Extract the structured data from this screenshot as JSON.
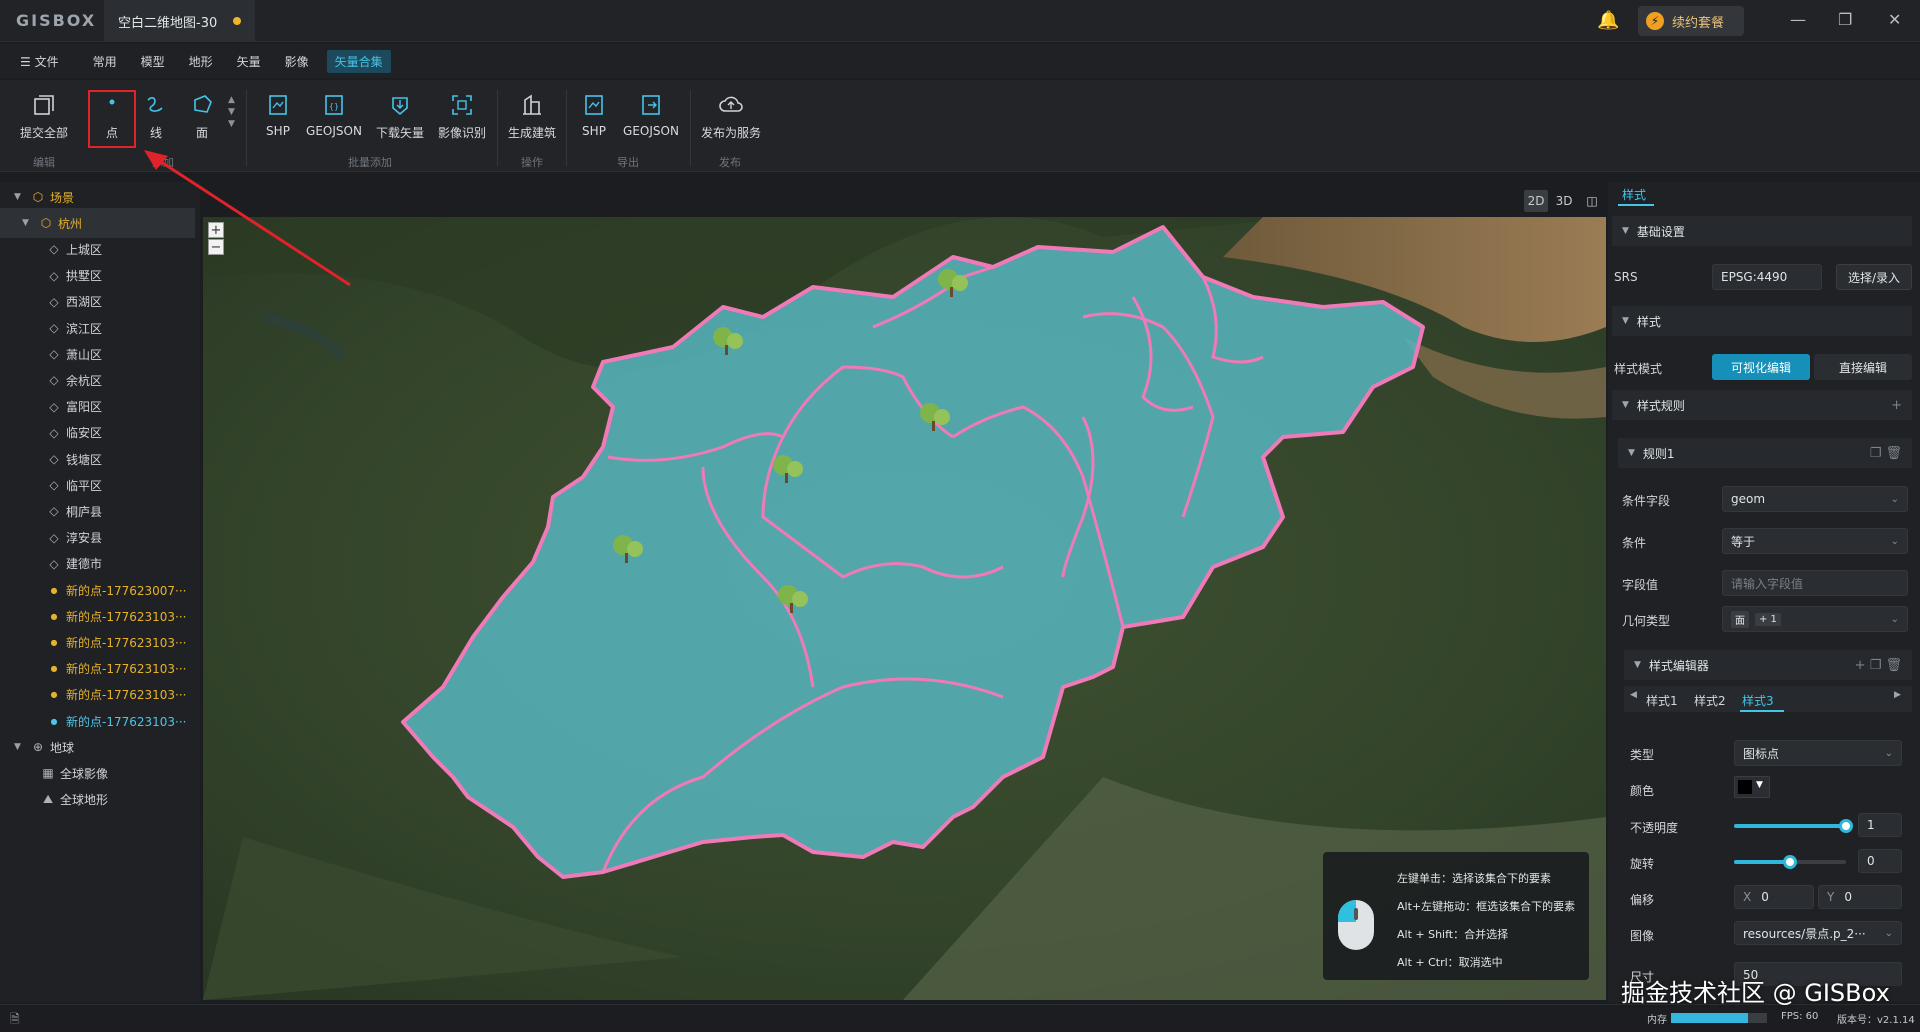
{
  "app": {
    "logo": "GISBOX",
    "doc_tab": "空白二维地图-30",
    "renew_label": "续约套餐"
  },
  "menu": [
    "文件",
    "常用",
    "模型",
    "地形",
    "矢量",
    "影像",
    "矢量合集"
  ],
  "ribbon": {
    "buttons": {
      "submit_all": "提交全部",
      "point": "点",
      "line": "线",
      "polygon": "面",
      "shp_import": "SHP",
      "geojson_import": "GEOJSON",
      "download_vector": "下载矢量",
      "image_recognition": "影像识别",
      "generate_building": "生成建筑",
      "shp_export": "SHP",
      "geojson_export": "GEOJSON",
      "publish_service": "发布为服务"
    },
    "groups": {
      "edit": "编辑",
      "add": "添加",
      "batch_add": "批量添加",
      "operation": "操作",
      "export": "导出",
      "publish": "发布"
    }
  },
  "tree": {
    "scene_label": "场景",
    "city_label": "杭州",
    "districts": [
      "上城区",
      "拱墅区",
      "西湖区",
      "滨江区",
      "萧山区",
      "余杭区",
      "富阳区",
      "临安区",
      "钱塘区",
      "临平区",
      "桐庐县",
      "淳安县",
      "建德市"
    ],
    "points": [
      "新的点-177623007···",
      "新的点-177623103···",
      "新的点-177623103···",
      "新的点-177623103···",
      "新的点-177623103···",
      "新的点-177623103···"
    ],
    "earth_label": "地球",
    "earth_children": [
      "全球影像",
      "全球地形"
    ]
  },
  "view_modes": [
    "2D",
    "3D"
  ],
  "map": {
    "zoom_in": "+",
    "zoom_out": "−",
    "hints": [
      "左键单击：选择该集合下的要素",
      "Alt+左键拖动：框选该集合下的要素",
      "Alt + Shift：合并选择",
      "Alt + Ctrl：取消选中"
    ]
  },
  "panel": {
    "tab": "样式",
    "basic_settings": "基础设置",
    "srs_label": "SRS",
    "srs_value": "EPSG:4490",
    "srs_button": "选择/录入",
    "style_section": "样式",
    "style_mode_label": "样式模式",
    "style_mode_visual": "可视化编辑",
    "style_mode_direct": "直接编辑",
    "style_rules": "样式规则",
    "rule1": "规则1",
    "cond_field_label": "条件字段",
    "cond_field_value": "geom",
    "cond_label": "条件",
    "cond_value": "等于",
    "field_value_label": "字段值",
    "field_value_placeholder": "请输入字段值",
    "geom_type_label": "几何类型",
    "geom_tag": "面",
    "geom_more": "+ 1",
    "style_editor": "样式编辑器",
    "style_tabs": [
      "样式1",
      "样式2",
      "样式3"
    ],
    "type_label": "类型",
    "type_value": "图标点",
    "color_label": "颜色",
    "opacity_label": "不透明度",
    "opacity_value": "1",
    "opacity_level": 1.0,
    "rotation_label": "旋转",
    "rotation_value": "0",
    "rotation_level": 0.5,
    "offset_label": "偏移",
    "offset_x_label": "X",
    "offset_x": "0",
    "offset_y_label": "Y",
    "offset_y": "0",
    "image_label": "图像",
    "image_value": "resources/景点.p_2···",
    "size_label": "尺寸",
    "size_value": "50"
  },
  "status": {
    "memory_label": "内存",
    "memory_level": 0.8,
    "fps": "FPS: 60",
    "version": "版本号：v2.1.14"
  },
  "watermark": "掘金技术社区 @ GISBox",
  "colors": {
    "accent": "#45c4e8",
    "highlight_box": "#e0232a",
    "boundary": "#f07ab8",
    "region_fill": "#58b9c4",
    "unsaved_dot": "#f0b429"
  }
}
